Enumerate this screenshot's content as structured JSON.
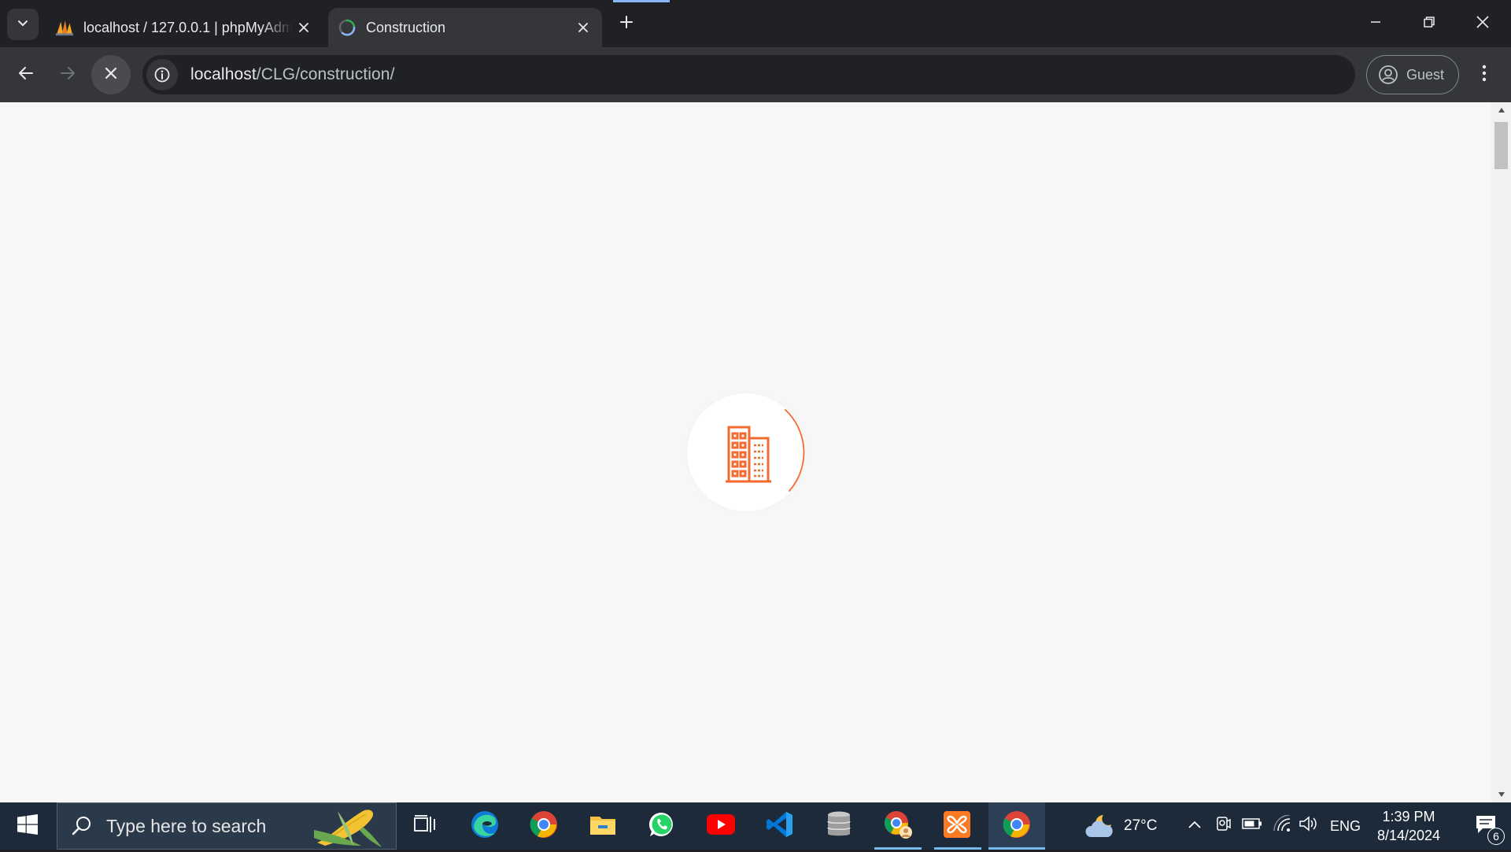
{
  "browser": {
    "tabs": [
      {
        "title": "localhost / 127.0.0.1 | phpMyAdmin",
        "favicon": "phpmyadmin-icon",
        "active": false
      },
      {
        "title": "Construction",
        "favicon": "page-loading-icon",
        "active": true
      }
    ],
    "address_bar": {
      "host": "localhost",
      "path": "/CLG/construction/"
    },
    "profile_label": "Guest"
  },
  "page": {
    "loader_icon": "building-icon",
    "accent_color": "#f26a2e",
    "background": "#f7f7f7"
  },
  "taskbar": {
    "search_placeholder": "Type here to search",
    "pinned_apps": [
      "task-view-icon",
      "edge-icon",
      "chrome-icon",
      "file-explorer-icon",
      "whatsapp-icon",
      "youtube-icon",
      "vscode-icon",
      "database-icon",
      "chrome-profile-icon",
      "xampp-icon",
      "chrome-icon"
    ],
    "weather": {
      "temperature": "27°C",
      "icon": "partly-cloudy-night-icon"
    },
    "language": "ENG",
    "time": "1:39 PM",
    "date": "8/14/2024",
    "notification_count": "6"
  }
}
